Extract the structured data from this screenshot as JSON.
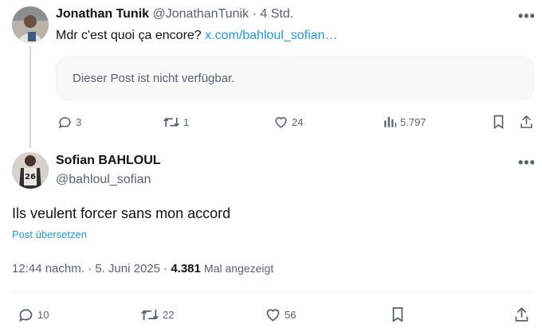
{
  "quoted_post": {
    "author_name": "Jonathan Tunik",
    "author_handle": "@JonathanTunik",
    "dot": "·",
    "time": "4 Std.",
    "text": "Mdr c'est quoi ça encore?",
    "link": "x.com/bahloul_sofian…",
    "unavailable_text": "Dieser Post ist nicht verfügbar.",
    "actions": {
      "replies": "3",
      "reposts": "1",
      "likes": "24",
      "views": "5.797"
    }
  },
  "main_post": {
    "author_name": "Sofian BAHLOUL",
    "author_handle": "@bahloul_sofian",
    "text": "Ils veulent forcer sans mon accord",
    "translate_label": "Post übersetzen",
    "time": "12:44 nachm.",
    "sep1": "·",
    "date": "5. Juni 2025",
    "sep2": "·",
    "views_count": "4.381",
    "views_label": "Mal angezeigt",
    "actions": {
      "replies": "10",
      "reposts": "22",
      "likes": "56"
    },
    "jersey_number": "26"
  },
  "more_label": "•••",
  "colors": {
    "accent": "#1d9bf0",
    "muted": "#536471",
    "text": "#0f1419"
  }
}
